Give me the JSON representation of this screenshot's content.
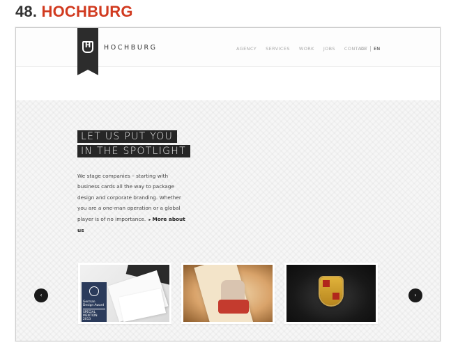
{
  "article": {
    "number": "48.",
    "name": "HOCHBURG"
  },
  "header": {
    "logo_letter": "H",
    "brand": "HOCHBURG",
    "nav": [
      "AGENCY",
      "SERVICES",
      "WORK",
      "JOBS",
      "CONTACT"
    ],
    "lang": {
      "de": "DE",
      "en": "EN"
    }
  },
  "hero": {
    "headline_line1": "LET US PUT YOU",
    "headline_line2": "IN THE SPOTLIGHT",
    "intro": "We stage companies – starting with business cards all the way to package design and corporate branding. Whether you are a one-man operation or a global player is of no importance.",
    "more_link": "More about us"
  },
  "carousel": {
    "award": {
      "line1": "German",
      "line2": "Design Award",
      "line3": "SPECIAL",
      "line4": "MENTION 2013"
    },
    "prev_icon": "chevron-left-icon",
    "next_icon": "chevron-right-icon"
  },
  "colors": {
    "accent": "#d13a1f",
    "dark": "#262626",
    "muted_nav": "#a9a9a9"
  }
}
